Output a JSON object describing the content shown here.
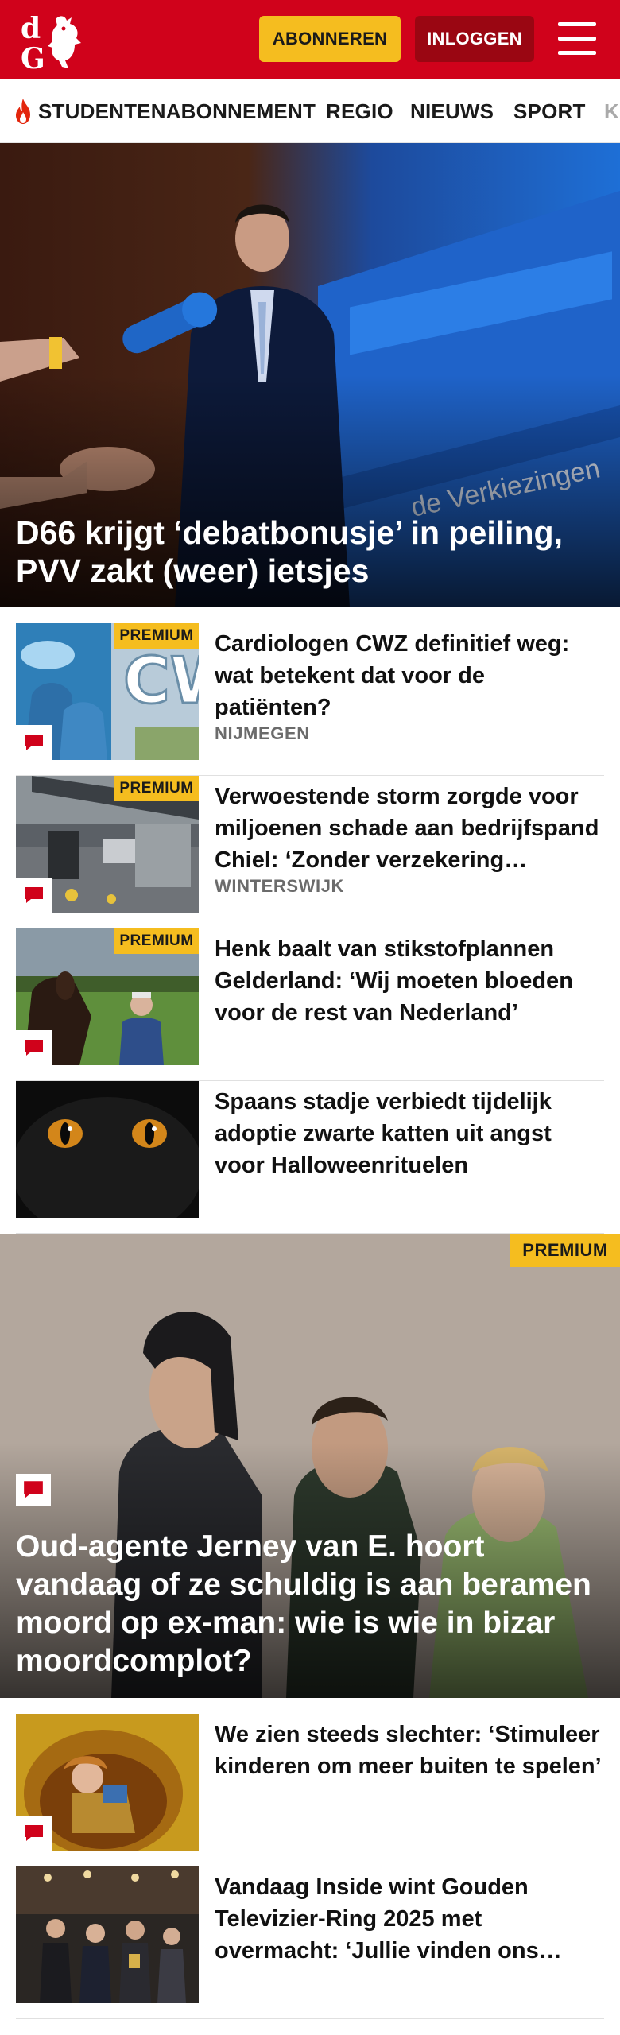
{
  "header": {
    "brand_colors": {
      "red": "#d0021b",
      "dark_red": "#9a0612",
      "yellow": "#f5bd1f"
    },
    "subscribe_label": "ABONNEREN",
    "login_label": "INLOGGEN",
    "menu_icon": "hamburger-icon"
  },
  "nav": {
    "items": [
      {
        "label": "STUDENTENABONNEMENT",
        "icon": "flame-icon"
      },
      {
        "label": "REGIO"
      },
      {
        "label": "NIEUWS"
      },
      {
        "label": "SPORT"
      },
      {
        "label": "K"
      }
    ]
  },
  "hero": {
    "title": "D66 krijgt ‘debatbonusje’ in peiling, PVV zakt (weer) ietsjes"
  },
  "articles": [
    {
      "title": "Cardiologen CWZ definitief weg: wat betekent dat voor de patiënten?",
      "region": "NIJMEGEN",
      "premium": "PREMIUM",
      "comment_icon": "comment-icon"
    },
    {
      "title": "Verwoestende storm zorgde voor miljoenen schade aan bedrijfs­pand Chiel: ‘Zonder verzekering…",
      "region": "WINTERSWIJK",
      "premium": "PREMIUM",
      "comment_icon": "comment-icon"
    },
    {
      "title": "Henk baalt van stikstofplannen Gelderland: ‘Wij moeten bloeden voor de rest van Nederland’",
      "premium": "PREMIUM",
      "comment_icon": "comment-icon"
    },
    {
      "title": "Spaans stadje verbiedt tijdelijk adoptie zwarte katten uit angst voor Halloweenrituelen"
    }
  ],
  "feature": {
    "premium": "PREMIUM",
    "title": "Oud-agente Jerney van E. hoort vandaag of ze schuldig is aan beramen moord op ex-man: wie is wie in bizar moordcomplot?",
    "comment_icon": "comment-icon"
  },
  "articles2": [
    {
      "title": "We zien steeds slechter: ‘Stimuleer kinderen om meer buiten te spelen’",
      "comment_icon": "comment-icon"
    },
    {
      "title": "Vandaag Inside wint Gouden Televizier-Ring 2025 met overmacht: ‘Jullie vinden ons…"
    }
  ]
}
